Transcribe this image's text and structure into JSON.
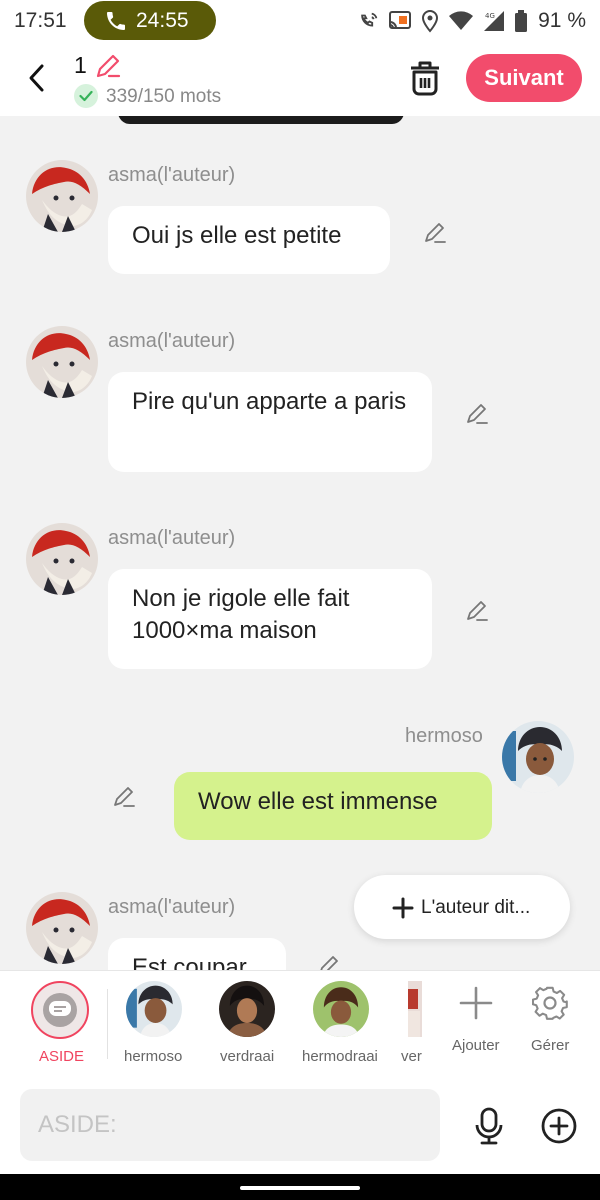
{
  "status_bar": {
    "time": "17:51",
    "call_timer": "24:55",
    "battery": "91 %",
    "call_pill_color": "#5a5a08",
    "icons": [
      "phone-icon",
      "wifi-calling-icon",
      "cast-icon",
      "location-icon",
      "wifi-icon",
      "signal-4g-icon",
      "battery-icon"
    ]
  },
  "header": {
    "chapter_number": "1",
    "word_count": "339/150 mots",
    "next_label": "Suivant",
    "accent": "#f24c6c"
  },
  "messages": [
    {
      "author": "asma(l'auteur)",
      "text": "Oui js elle est petite",
      "side": "left"
    },
    {
      "author": "asma(l'auteur)",
      "text": "Pire qu'un apparte a paris",
      "side": "left"
    },
    {
      "author": "asma(l'auteur)",
      "text": "Non je rigole elle fait 1000×ma maison",
      "side": "left"
    },
    {
      "author": "hermoso",
      "text": "Wow elle est immense",
      "side": "right",
      "bubble_color": "#d5f28d"
    },
    {
      "author": "asma(l'auteur)",
      "text": "Est coupar",
      "side": "left"
    }
  ],
  "floating": {
    "add_label": "L'auteur dit..."
  },
  "characters": {
    "aside_label": "ASIDE",
    "items": [
      {
        "label": "hermoso"
      },
      {
        "label": "verdraai"
      },
      {
        "label": "hermodraai"
      },
      {
        "label": "ver"
      }
    ],
    "add_label": "Ajouter",
    "manage_label": "Gérer"
  },
  "input": {
    "placeholder": "ASIDE:"
  }
}
